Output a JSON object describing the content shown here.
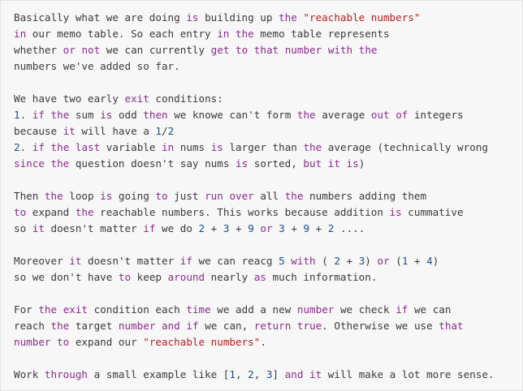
{
  "lines": [
    [
      [
        "t",
        "Basically what we are doing "
      ],
      [
        "k",
        "is"
      ],
      [
        "t",
        " building up "
      ],
      [
        "k",
        "the"
      ],
      [
        "t",
        " "
      ],
      [
        "s",
        "\"reachable numbers\""
      ]
    ],
    [
      [
        "k",
        "in"
      ],
      [
        "t",
        " our memo table. So each entry "
      ],
      [
        "k",
        "in"
      ],
      [
        "t",
        " "
      ],
      [
        "k",
        "the"
      ],
      [
        "t",
        " memo table represents"
      ]
    ],
    [
      [
        "t",
        "whether "
      ],
      [
        "k",
        "or"
      ],
      [
        "t",
        " "
      ],
      [
        "k",
        "not"
      ],
      [
        "t",
        " we can currently "
      ],
      [
        "k",
        "get"
      ],
      [
        "t",
        " "
      ],
      [
        "k",
        "to"
      ],
      [
        "t",
        " "
      ],
      [
        "k",
        "that"
      ],
      [
        "t",
        " "
      ],
      [
        "k",
        "number"
      ],
      [
        "t",
        " "
      ],
      [
        "k",
        "with"
      ],
      [
        "t",
        " "
      ],
      [
        "k",
        "the"
      ]
    ],
    [
      [
        "t",
        "numbers we've added so far."
      ]
    ],
    [
      [
        "t",
        ""
      ]
    ],
    [
      [
        "t",
        "We have two early "
      ],
      [
        "k",
        "exit"
      ],
      [
        "t",
        " conditions:"
      ]
    ],
    [
      [
        "n",
        "1."
      ],
      [
        "t",
        " "
      ],
      [
        "k",
        "if"
      ],
      [
        "t",
        " "
      ],
      [
        "k",
        "the"
      ],
      [
        "t",
        " sum "
      ],
      [
        "k",
        "is"
      ],
      [
        "t",
        " odd "
      ],
      [
        "k",
        "then"
      ],
      [
        "t",
        " we knowe can't form "
      ],
      [
        "k",
        "the"
      ],
      [
        "t",
        " average "
      ],
      [
        "k",
        "out"
      ],
      [
        "t",
        " "
      ],
      [
        "k",
        "of"
      ],
      [
        "t",
        " integers"
      ]
    ],
    [
      [
        "t",
        "because "
      ],
      [
        "k",
        "it"
      ],
      [
        "t",
        " will have a "
      ],
      [
        "n",
        "1"
      ],
      [
        "t",
        "/"
      ],
      [
        "n",
        "2"
      ]
    ],
    [
      [
        "n",
        "2."
      ],
      [
        "t",
        " "
      ],
      [
        "k",
        "if"
      ],
      [
        "t",
        " "
      ],
      [
        "k",
        "the"
      ],
      [
        "t",
        " "
      ],
      [
        "k",
        "last"
      ],
      [
        "t",
        " variable "
      ],
      [
        "k",
        "in"
      ],
      [
        "t",
        " nums "
      ],
      [
        "k",
        "is"
      ],
      [
        "t",
        " larger than "
      ],
      [
        "k",
        "the"
      ],
      [
        "t",
        " average (technically wrong"
      ]
    ],
    [
      [
        "k",
        "since"
      ],
      [
        "t",
        " "
      ],
      [
        "k",
        "the"
      ],
      [
        "t",
        " question doesn't say nums "
      ],
      [
        "k",
        "is"
      ],
      [
        "t",
        " sorted, "
      ],
      [
        "k",
        "but"
      ],
      [
        "t",
        " "
      ],
      [
        "k",
        "it"
      ],
      [
        "t",
        " "
      ],
      [
        "k",
        "is"
      ],
      [
        "t",
        ")"
      ]
    ],
    [
      [
        "t",
        ""
      ]
    ],
    [
      [
        "t",
        "Then "
      ],
      [
        "k",
        "the"
      ],
      [
        "t",
        " loop "
      ],
      [
        "k",
        "is"
      ],
      [
        "t",
        " going "
      ],
      [
        "k",
        "to"
      ],
      [
        "t",
        " just "
      ],
      [
        "k",
        "run"
      ],
      [
        "t",
        " "
      ],
      [
        "k",
        "over"
      ],
      [
        "t",
        " all "
      ],
      [
        "k",
        "the"
      ],
      [
        "t",
        " numbers adding them"
      ]
    ],
    [
      [
        "k",
        "to"
      ],
      [
        "t",
        " expand "
      ],
      [
        "k",
        "the"
      ],
      [
        "t",
        " reachable numbers. This works because addition "
      ],
      [
        "k",
        "is"
      ],
      [
        "t",
        " cummative"
      ]
    ],
    [
      [
        "t",
        "so "
      ],
      [
        "k",
        "it"
      ],
      [
        "t",
        " doesn't matter "
      ],
      [
        "k",
        "if"
      ],
      [
        "t",
        " we do "
      ],
      [
        "n",
        "2"
      ],
      [
        "t",
        " + "
      ],
      [
        "n",
        "3"
      ],
      [
        "t",
        " + "
      ],
      [
        "n",
        "9"
      ],
      [
        "t",
        " "
      ],
      [
        "k",
        "or"
      ],
      [
        "t",
        " "
      ],
      [
        "n",
        "3"
      ],
      [
        "t",
        " + "
      ],
      [
        "n",
        "9"
      ],
      [
        "t",
        " + "
      ],
      [
        "n",
        "2"
      ],
      [
        "t",
        " ...."
      ]
    ],
    [
      [
        "t",
        ""
      ]
    ],
    [
      [
        "t",
        "Moreover "
      ],
      [
        "k",
        "it"
      ],
      [
        "t",
        " doesn't matter "
      ],
      [
        "k",
        "if"
      ],
      [
        "t",
        " we can reacg "
      ],
      [
        "n",
        "5"
      ],
      [
        "t",
        " "
      ],
      [
        "k",
        "with"
      ],
      [
        "t",
        " ( "
      ],
      [
        "n",
        "2"
      ],
      [
        "t",
        " + "
      ],
      [
        "n",
        "3"
      ],
      [
        "t",
        ") "
      ],
      [
        "k",
        "or"
      ],
      [
        "t",
        " ("
      ],
      [
        "n",
        "1"
      ],
      [
        "t",
        " + "
      ],
      [
        "n",
        "4"
      ],
      [
        "t",
        ")"
      ]
    ],
    [
      [
        "t",
        "so we don't have "
      ],
      [
        "k",
        "to"
      ],
      [
        "t",
        " keep "
      ],
      [
        "k",
        "around"
      ],
      [
        "t",
        " nearly "
      ],
      [
        "k",
        "as"
      ],
      [
        "t",
        " much information."
      ]
    ],
    [
      [
        "t",
        ""
      ]
    ],
    [
      [
        "t",
        "For "
      ],
      [
        "k",
        "the"
      ],
      [
        "t",
        " "
      ],
      [
        "k",
        "exit"
      ],
      [
        "t",
        " condition each "
      ],
      [
        "k",
        "time"
      ],
      [
        "t",
        " we add a new "
      ],
      [
        "k",
        "number"
      ],
      [
        "t",
        " we check "
      ],
      [
        "k",
        "if"
      ],
      [
        "t",
        " we can"
      ]
    ],
    [
      [
        "t",
        "reach "
      ],
      [
        "k",
        "the"
      ],
      [
        "t",
        " target "
      ],
      [
        "k",
        "number"
      ],
      [
        "t",
        " "
      ],
      [
        "k",
        "and"
      ],
      [
        "t",
        " "
      ],
      [
        "k",
        "if"
      ],
      [
        "t",
        " we can, "
      ],
      [
        "k",
        "return"
      ],
      [
        "t",
        " "
      ],
      [
        "k",
        "true"
      ],
      [
        "t",
        ". Otherwise we use "
      ],
      [
        "k",
        "that"
      ]
    ],
    [
      [
        "k",
        "number"
      ],
      [
        "t",
        " "
      ],
      [
        "k",
        "to"
      ],
      [
        "t",
        " expand our "
      ],
      [
        "s",
        "\"reachable numbers\""
      ],
      [
        "t",
        "."
      ]
    ],
    [
      [
        "t",
        ""
      ]
    ],
    [
      [
        "t",
        "Work "
      ],
      [
        "k",
        "through"
      ],
      [
        "t",
        " a small example like ["
      ],
      [
        "n",
        "1"
      ],
      [
        "t",
        ", "
      ],
      [
        "n",
        "2"
      ],
      [
        "t",
        ", "
      ],
      [
        "n",
        "3"
      ],
      [
        "t",
        "] "
      ],
      [
        "k",
        "and"
      ],
      [
        "t",
        " "
      ],
      [
        "k",
        "it"
      ],
      [
        "t",
        " will make a lot more sense."
      ]
    ]
  ],
  "colors": {
    "keyword": "#8a2c8a",
    "string": "#b22222",
    "number": "#1d4e89",
    "text": "#3a3a3a",
    "background": "#f7f7f8"
  }
}
